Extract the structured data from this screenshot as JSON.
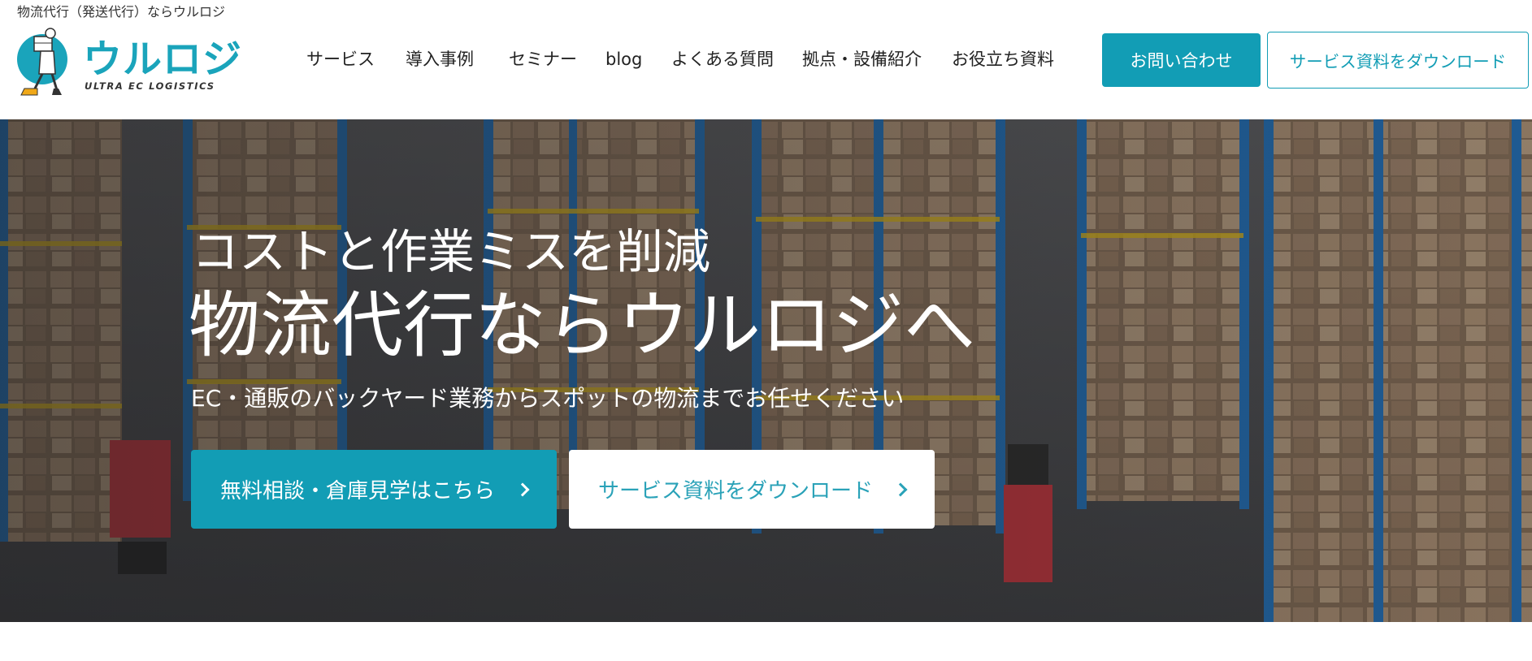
{
  "header": {
    "tagline": "物流代行（発送代行）ならウルロジ",
    "logo": {
      "wordmark": "ウルロジ",
      "subtitle": "ULTRA EC LOGISTICS"
    },
    "nav": [
      {
        "label": "サービス"
      },
      {
        "label": "導入事例"
      },
      {
        "label": "セミナー"
      },
      {
        "label": "blog"
      },
      {
        "label": "よくある質問"
      },
      {
        "label": "拠点・設備紹介"
      },
      {
        "label": "お役立ち資料"
      }
    ],
    "contact_button": "お問い合わせ",
    "download_button": "サービス資料をダウンロード"
  },
  "hero": {
    "lead": "コストと作業ミスを削減",
    "title": "物流代行ならウルロジへ",
    "description": "EC・通販のバックヤード業務からスポットの物流までお任せください",
    "primary_button": "無料相談・倉庫見学はこちら",
    "secondary_button": "サービス資料をダウンロード"
  },
  "colors": {
    "brand": "#129db5",
    "text": "#222222",
    "hero_text": "#ffffff"
  },
  "icons": {
    "logo_mascot": "delivery-mascot-icon",
    "button_arrow": "chevron-right-icon"
  }
}
